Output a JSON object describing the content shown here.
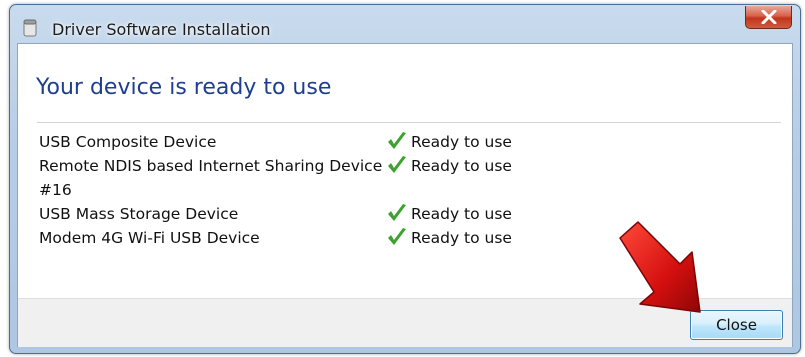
{
  "window": {
    "title": "Driver Software Installation",
    "close_icon": "close-x-icon"
  },
  "content": {
    "heading": "Your device is ready to use",
    "devices": [
      {
        "name": "USB Composite Device",
        "status": "Ready to use",
        "icon": "green-check-icon"
      },
      {
        "name": "Remote NDIS based Internet Sharing Device #16",
        "status": "Ready to use",
        "icon": "green-check-icon"
      },
      {
        "name": "USB Mass Storage Device",
        "status": "Ready to use",
        "icon": "green-check-icon"
      },
      {
        "name": "Modem 4G Wi-Fi USB Device",
        "status": "Ready to use",
        "icon": "green-check-icon"
      }
    ]
  },
  "footer": {
    "close_label": "Close"
  },
  "annotation": {
    "icon": "red-arrow-icon",
    "color": "#d40f0f"
  },
  "colors": {
    "heading": "#1f3e8e",
    "check": "#3fa130",
    "close_accent": "#c2351c"
  }
}
